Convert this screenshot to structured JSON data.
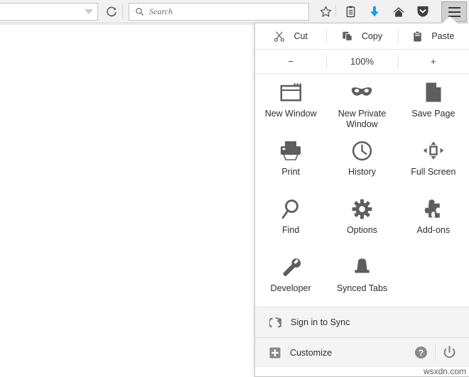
{
  "browser": {
    "urlbar": {
      "value": "",
      "chevron_icon": "chevron-down-icon"
    },
    "reload_icon": "reload-icon",
    "search": {
      "placeholder": "Search",
      "icon": "search-icon"
    },
    "toolbar_icons": [
      {
        "name": "bookmark-star-icon",
        "title": "Bookmark"
      },
      {
        "name": "reader-list-icon",
        "title": "Reading List"
      },
      {
        "name": "download-arrow-icon",
        "title": "Downloads",
        "color": "#1a9bf0"
      },
      {
        "name": "home-icon",
        "title": "Home"
      },
      {
        "name": "pocket-icon",
        "title": "Pocket"
      }
    ],
    "menu_button": {
      "name": "hamburger-menu-button",
      "label": "Open menu"
    }
  },
  "panel": {
    "edit_row": [
      {
        "label": "Cut",
        "icon": "scissors-icon"
      },
      {
        "label": "Copy",
        "icon": "copy-icon"
      },
      {
        "label": "Paste",
        "icon": "clipboard-icon"
      }
    ],
    "zoom_row": {
      "minus_label": "−",
      "level": "100%",
      "plus_label": "+"
    },
    "grid": [
      {
        "label": "New Window",
        "icon": "new-window-icon"
      },
      {
        "label": "New Private Window",
        "icon": "mask-icon"
      },
      {
        "label": "Save Page",
        "icon": "page-icon"
      },
      {
        "label": "Print",
        "icon": "printer-icon"
      },
      {
        "label": "History",
        "icon": "clock-icon"
      },
      {
        "label": "Full Screen",
        "icon": "fullscreen-icon"
      },
      {
        "label": "Find",
        "icon": "magnifier-icon"
      },
      {
        "label": "Options",
        "icon": "gear-icon"
      },
      {
        "label": "Add-ons",
        "icon": "puzzle-icon"
      },
      {
        "label": "Developer",
        "icon": "wrench-icon"
      },
      {
        "label": "Synced Tabs",
        "icon": "synced-tabs-icon"
      }
    ],
    "sync": {
      "label": "Sign in to Sync",
      "icon": "sync-icon"
    },
    "customize": {
      "label": "Customize",
      "icon": "plus-box-icon"
    },
    "footer_buttons": [
      {
        "name": "help-button",
        "icon": "question-circle-icon",
        "title": "Help"
      },
      {
        "name": "quit-button",
        "icon": "power-icon",
        "title": "Quit"
      }
    ]
  },
  "watermark": {
    "text": "wsxdn.com"
  },
  "colors": {
    "chrome_bg": "#f1f1f1",
    "panel_bg": "#ffffff",
    "footer_bg": "#f4f4f4",
    "icon_gray": "#606060",
    "download_blue": "#1a9bf0"
  }
}
